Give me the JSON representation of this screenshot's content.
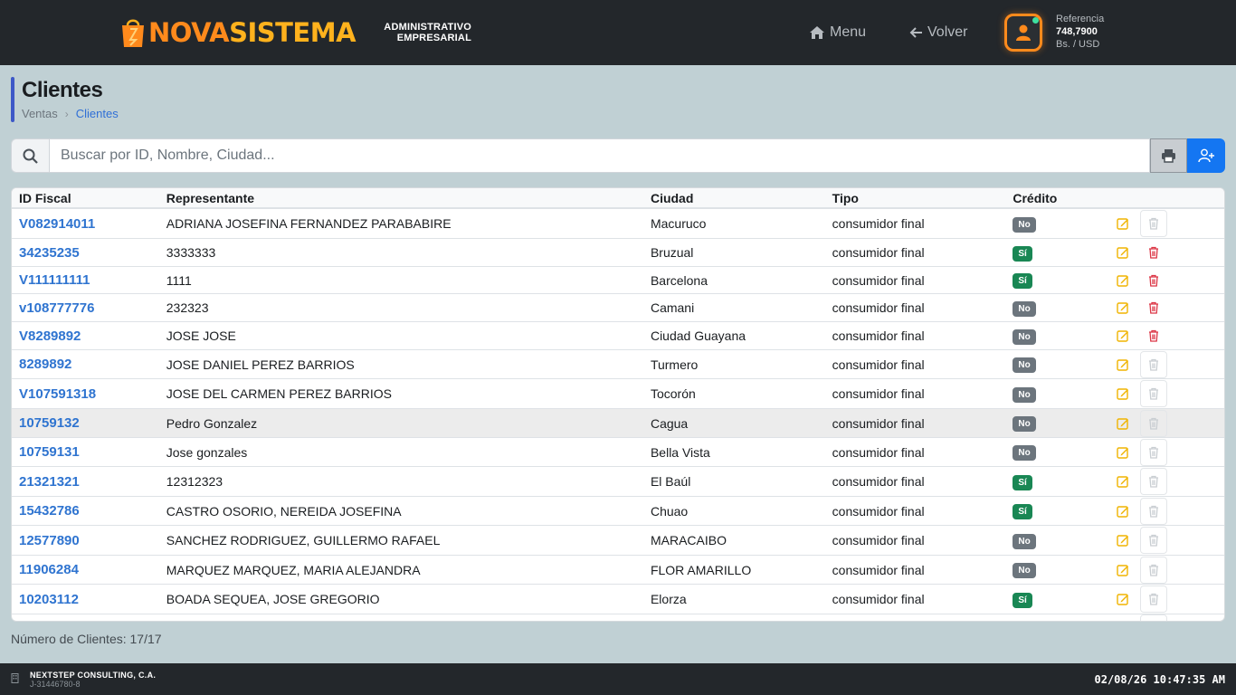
{
  "header": {
    "brand_part1": "NOVA",
    "brand_part2": "SISTEMA",
    "brand_sub_line1": "ADMINISTRATIVO",
    "brand_sub_line2": "EMPRESARIAL",
    "menu_label": "Menu",
    "back_label": "Volver",
    "reference_label": "Referencia",
    "reference_value": "748,7900",
    "reference_unit": "Bs. / USD"
  },
  "page": {
    "title": "Clientes",
    "breadcrumb": [
      "Ventas",
      "Clientes"
    ],
    "breadcrumb_sep": "›"
  },
  "search": {
    "placeholder": "Buscar por ID, Nombre, Ciudad...",
    "value": ""
  },
  "table": {
    "headers": [
      "ID Fiscal",
      "Representante",
      "Ciudad",
      "Tipo",
      "Crédito",
      ""
    ],
    "rows": [
      {
        "id": "V082914011",
        "rep": "ADRIANA JOSEFINA FERNANDEZ PARABABIRE",
        "city": "Macuruco",
        "type": "consumidor final",
        "credit": "No",
        "deletable": false,
        "h": 33
      },
      {
        "id": "34235235",
        "rep": "3333333",
        "city": "Bruzual",
        "type": "consumidor final",
        "credit": "Sí",
        "deletable": true,
        "h": 31
      },
      {
        "id": "V111111111",
        "rep": "1111",
        "city": "Barcelona",
        "type": "consumidor final",
        "credit": "Sí",
        "deletable": true,
        "h": 30
      },
      {
        "id": "v108777776",
        "rep": "232323",
        "city": "Camani",
        "type": "consumidor final",
        "credit": "No",
        "deletable": true,
        "h": 31
      },
      {
        "id": "V8289892",
        "rep": "JOSE JOSE",
        "city": "Ciudad Guayana",
        "type": "consumidor final",
        "credit": "No",
        "deletable": true,
        "h": 31
      },
      {
        "id": "8289892",
        "rep": "JOSE DANIEL PEREZ BARRIOS",
        "city": "Turmero",
        "type": "consumidor final",
        "credit": "No",
        "deletable": false,
        "h": 32
      },
      {
        "id": "V107591318",
        "rep": "JOSE DEL CARMEN PEREZ BARRIOS",
        "city": "Tocorón",
        "type": "consumidor final",
        "credit": "No",
        "deletable": false,
        "h": 33
      },
      {
        "id": "10759132",
        "rep": "Pedro Gonzalez",
        "city": "Cagua",
        "type": "consumidor final",
        "credit": "No",
        "deletable": false,
        "h": 32,
        "highlight": true
      },
      {
        "id": "10759131",
        "rep": "Jose gonzales",
        "city": "Bella Vista",
        "type": "consumidor final",
        "credit": "No",
        "deletable": false,
        "h": 32
      },
      {
        "id": "21321321",
        "rep": "12312323",
        "city": "El Baúl",
        "type": "consumidor final",
        "credit": "Sí",
        "deletable": false,
        "h": 33
      },
      {
        "id": "15432786",
        "rep": "CASTRO OSORIO, NEREIDA JOSEFINA",
        "city": "Chuao",
        "type": "consumidor final",
        "credit": "Sí",
        "deletable": false,
        "h": 32
      },
      {
        "id": "12577890",
        "rep": "SANCHEZ RODRIGUEZ, GUILLERMO RAFAEL",
        "city": "MARACAIBO",
        "type": "consumidor final",
        "credit": "No",
        "deletable": false,
        "h": 33
      },
      {
        "id": "11906284",
        "rep": "MARQUEZ MARQUEZ, MARIA ALEJANDRA",
        "city": "FLOR AMARILLO",
        "type": "consumidor final",
        "credit": "No",
        "deletable": false,
        "h": 32
      },
      {
        "id": "10203112",
        "rep": "BOADA SEQUEA, JOSE GREGORIO",
        "city": "Elorza",
        "type": "consumidor final",
        "credit": "Sí",
        "deletable": false,
        "h": 33
      }
    ]
  },
  "summary": {
    "count_text": "Número de Clientes: 17/17"
  },
  "footer": {
    "company": "NEXTSTEP CONSULTING, C.A.",
    "rif": "J-31446780-8",
    "datetime": "02/08/26 10:47:35 AM"
  },
  "colors": {
    "accent": "#1476f2",
    "brand_orange": "#ff8a1c",
    "credit_yes": "#198754",
    "credit_no": "#6c757d",
    "delete_red": "#dc3545",
    "edit_yellow": "#f0b400"
  }
}
